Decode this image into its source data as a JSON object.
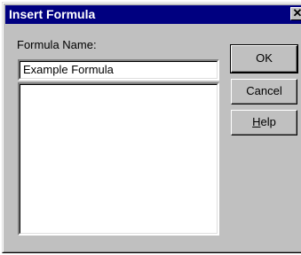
{
  "window": {
    "title": "Insert Formula",
    "close_glyph": "✕"
  },
  "form": {
    "name_label": "Formula Name:",
    "name_value": "Example Formula",
    "body_value": ""
  },
  "buttons": {
    "ok_label": "OK",
    "cancel_label": "Cancel",
    "help_mnemonic": "H",
    "help_rest": "elp"
  },
  "colors": {
    "titlebar": "#000080",
    "face": "#c0c0c0",
    "field": "#ffffff"
  }
}
